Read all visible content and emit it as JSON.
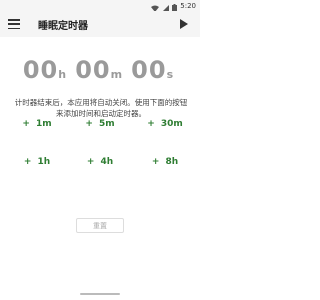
{
  "status_bar": {
    "time": "5:20",
    "icons": [
      "wifi-icon",
      "signal-icon",
      "battery-icon"
    ]
  },
  "app_bar": {
    "title": "睡眠定时器",
    "menu_icon": "menu-icon",
    "start_icon": "play-icon"
  },
  "timer": {
    "hours": "00",
    "hours_unit": "h",
    "minutes": "00",
    "minutes_unit": "m",
    "seconds": "00",
    "seconds_unit": "s"
  },
  "description": "计时器结束后，本应用将自动关闭。使用下面的按钮来添加时间和启动定时器。",
  "add_buttons": [
    {
      "plus": "+",
      "label": "1m"
    },
    {
      "plus": "+",
      "label": "5m"
    },
    {
      "plus": "+",
      "label": "30m"
    },
    {
      "plus": "+",
      "label": "1h"
    },
    {
      "plus": "+",
      "label": "4h"
    },
    {
      "plus": "+",
      "label": "8h"
    }
  ],
  "reset_label": "重置",
  "colors": {
    "accent": "#2e7d32",
    "timer_text": "#9a9a9a",
    "app_bar_bg": "#f5f5f5"
  }
}
